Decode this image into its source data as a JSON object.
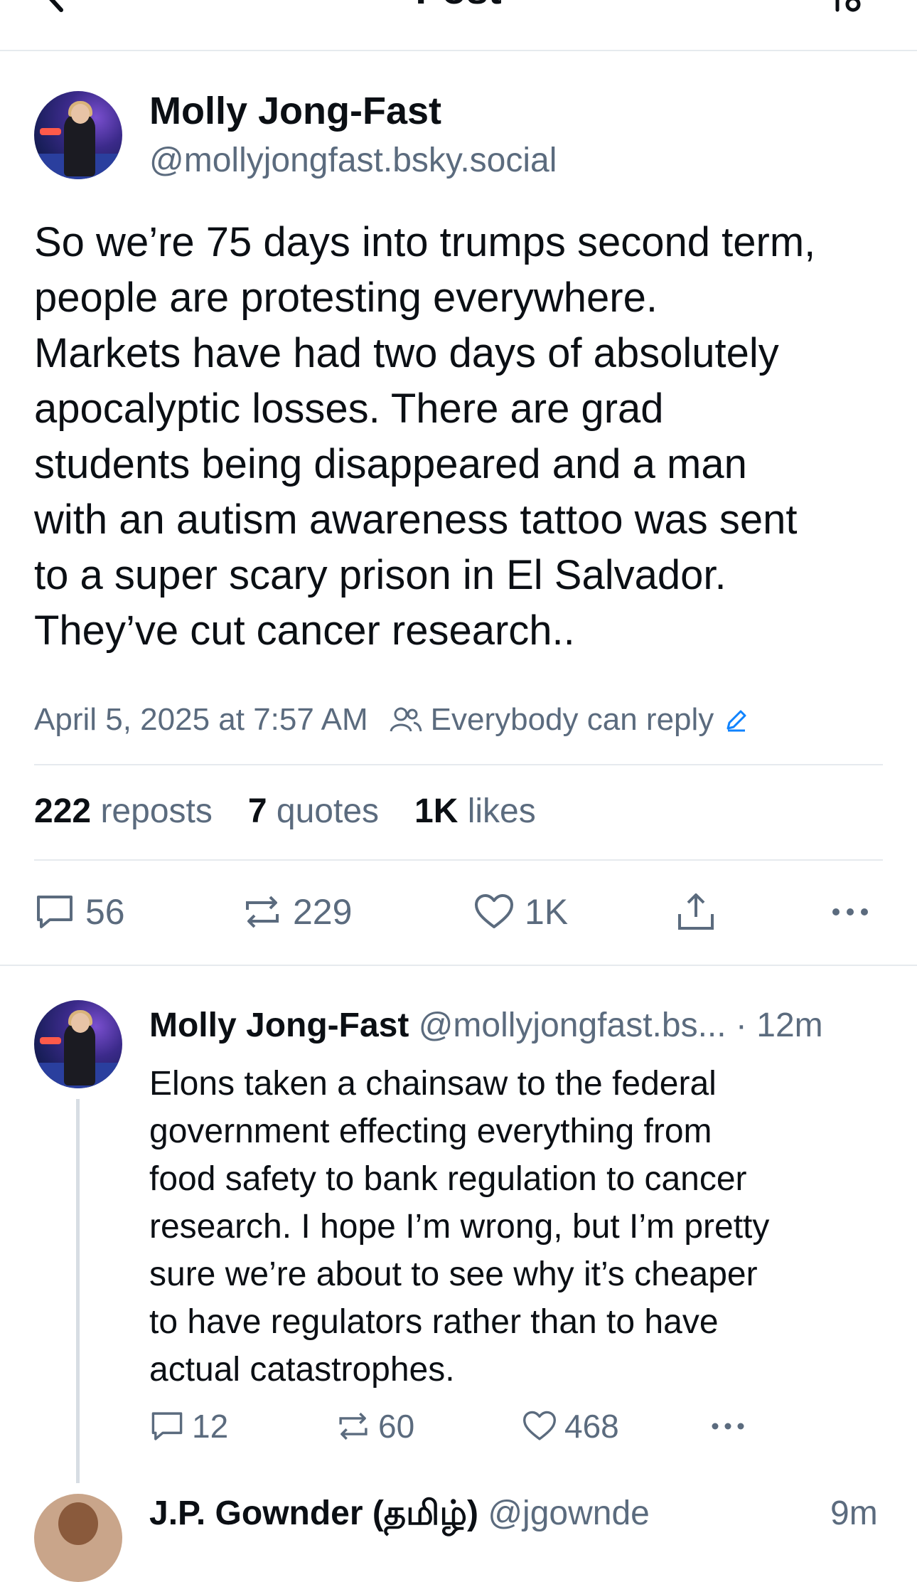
{
  "header": {
    "title": "Post",
    "sort_icon": "sort-icon",
    "back_icon": "chevron-left-icon"
  },
  "main_post": {
    "author_name": "Molly Jong-Fast",
    "author_handle": "@mollyjongfast.bsky.social",
    "text": "So we’re 75 days into trumps second term,\npeople are protesting everywhere.\nMarkets have had two days of absolutely\napocalyptic losses. There are grad\nstudents being disappeared and a man\nwith an autism awareness tattoo was sent\nto a super scary prison in El Salvador.\nThey’ve cut cancer research..",
    "timestamp": "April 5, 2025 at 7:57 AM",
    "reply_permission": "Everybody can reply",
    "stats": {
      "reposts_count": "222",
      "reposts_label": "reposts",
      "quotes_count": "7",
      "quotes_label": "quotes",
      "likes_count": "1K",
      "likes_label": "likes"
    },
    "actions": {
      "replies": "56",
      "reposts": "229",
      "likes": "1K"
    }
  },
  "reply": {
    "author_name": "Molly Jong-Fast",
    "author_handle": "@mollyjongfast.bs...",
    "time": "· 12m",
    "text": "Elons taken a chainsaw to the federal\ngovernment effecting everything from\nfood safety to bank regulation to cancer\nresearch. I hope I’m wrong, but I’m pretty\nsure we’re about to see why it’s cheaper\nto have regulators rather than to have\nactual catastrophes.",
    "actions": {
      "replies": "12",
      "reposts": "60",
      "likes": "468"
    }
  },
  "next_item": {
    "author_name": "J.P. Gownder (தமிழ்)",
    "author_handle": "@jgownde",
    "time": "9m"
  },
  "colors": {
    "text": "#0b0f14",
    "muted": "#5b6b7e",
    "accent": "#1083fe",
    "divider": "#e6eaee"
  }
}
